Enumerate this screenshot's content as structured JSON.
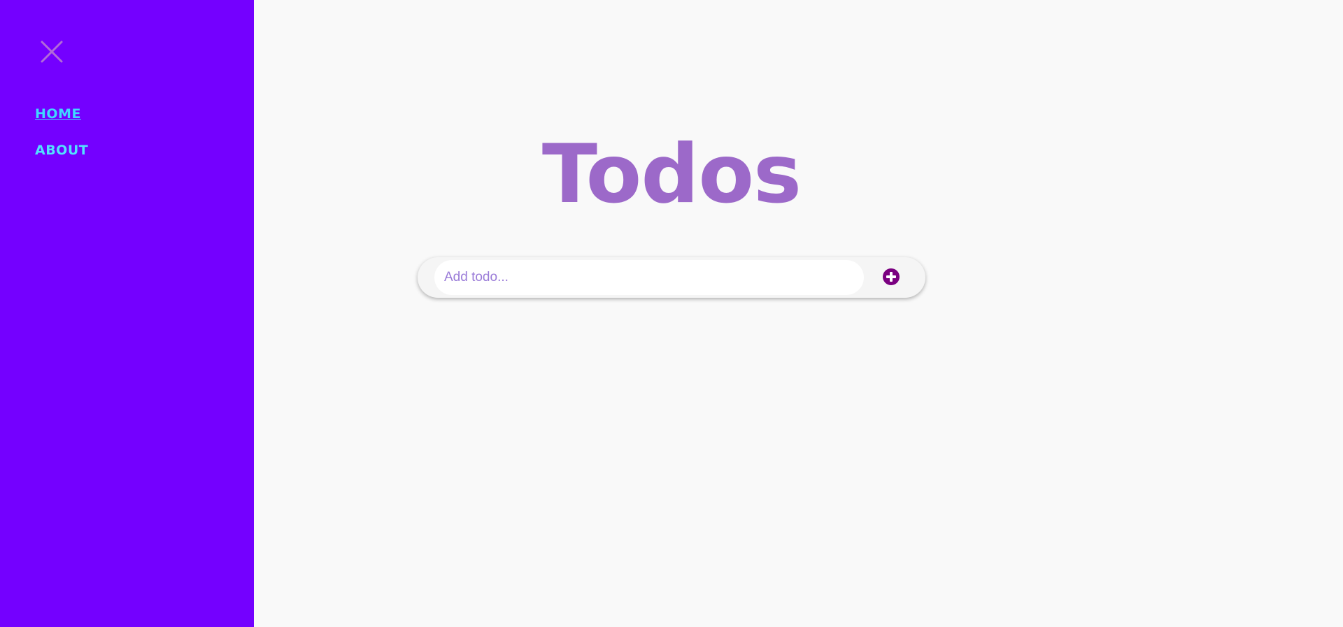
{
  "sidebar": {
    "close_icon": "close-icon",
    "nav": [
      {
        "label": "HOME",
        "active": true
      },
      {
        "label": "ABOUT",
        "active": false
      }
    ]
  },
  "main": {
    "title": "Todos",
    "todo_input": {
      "value": "",
      "placeholder": "Add todo..."
    },
    "add_icon": "plus-circle-icon"
  },
  "colors": {
    "sidebar_bg": "#7400ff",
    "nav_link": "#52e1ff",
    "title": "#9c69c9",
    "add_button": "#7a0080",
    "page_bg": "#f9f9f9"
  }
}
